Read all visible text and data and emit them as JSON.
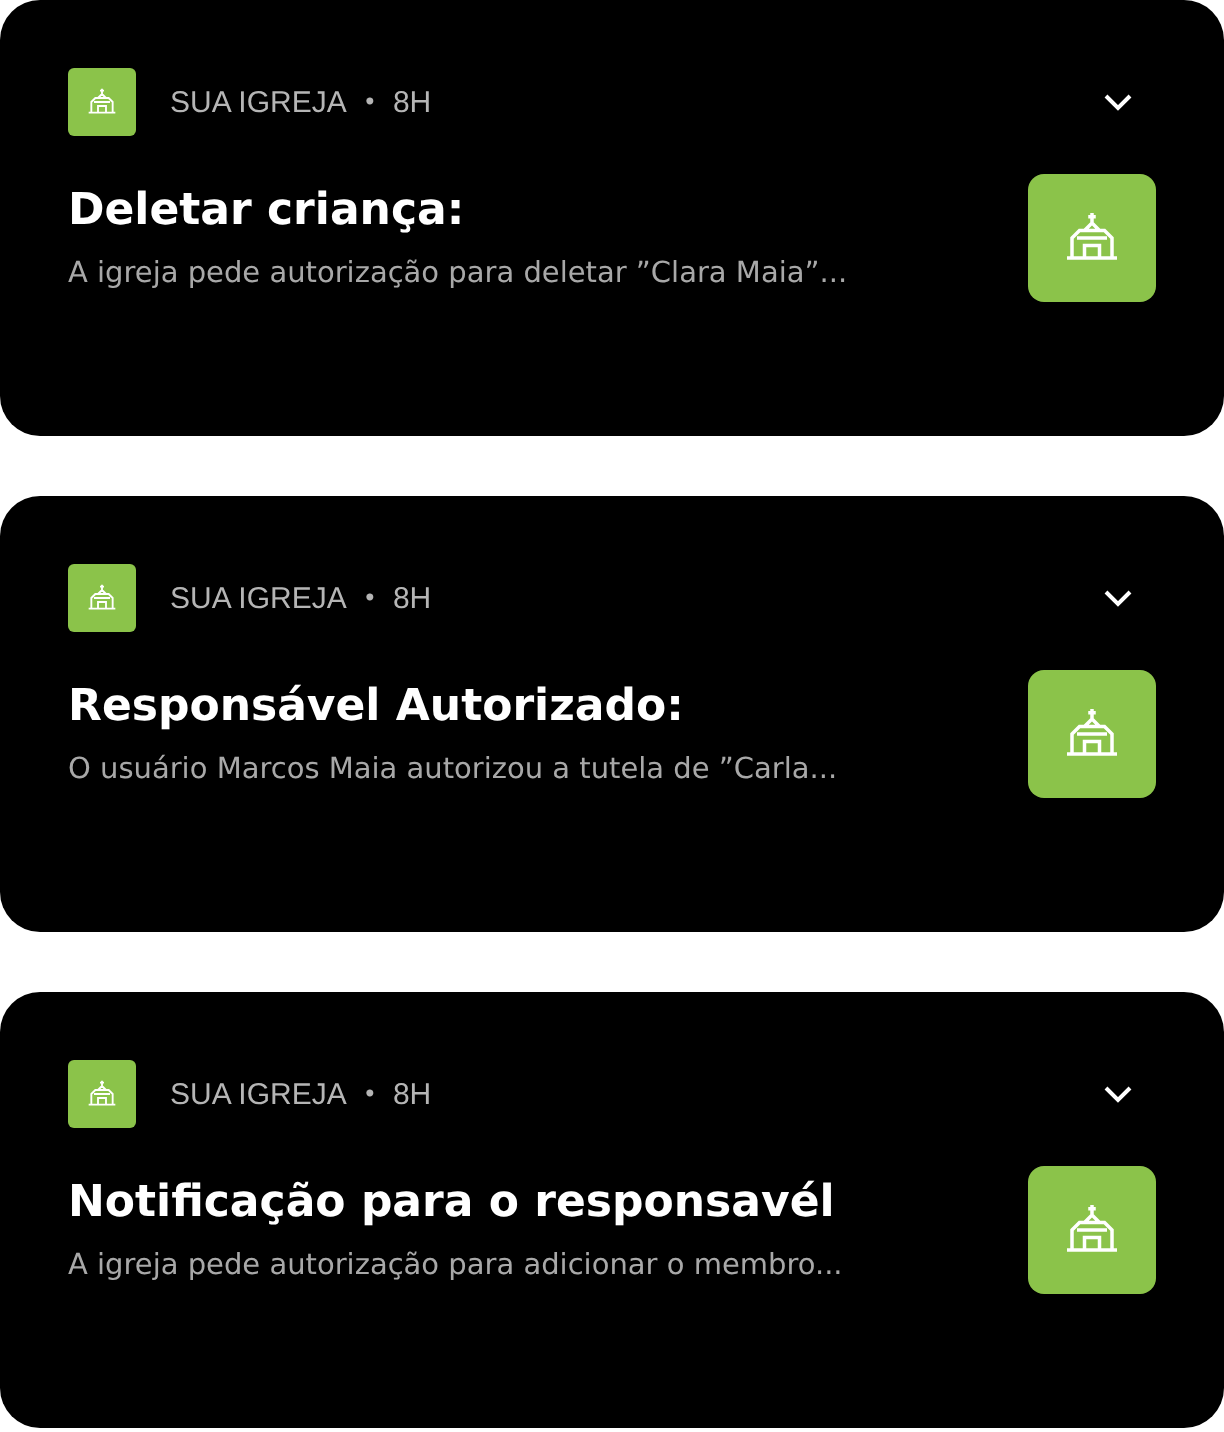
{
  "notifications": [
    {
      "app": "SUA IGREJA",
      "separator": "•",
      "time": "8H",
      "title": "Deletar criança:",
      "body": "A igreja pede autorização para deletar ”Clara Maia”..."
    },
    {
      "app": "SUA IGREJA",
      "separator": "•",
      "time": "8H",
      "title": "Responsável Autorizado:",
      "body": "O usuário Marcos Maia autorizou a tutela de ”Carla..."
    },
    {
      "app": "SUA IGREJA",
      "separator": "•",
      "time": "8H",
      "title": "Notificação para o responsavél",
      "body": "A igreja pede autorização para adicionar o membro..."
    }
  ]
}
